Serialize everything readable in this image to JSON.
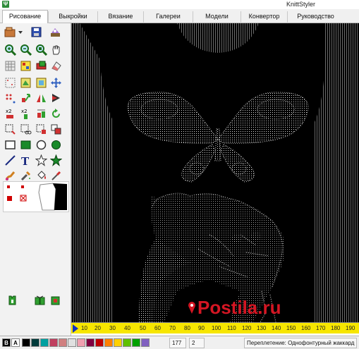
{
  "window": {
    "title": "KnittStyler",
    "icon_letter": "Ψ"
  },
  "tabs": [
    {
      "label": "Рисование",
      "active": true
    },
    {
      "label": "Выкройки",
      "active": false
    },
    {
      "label": "Вязание",
      "active": false
    },
    {
      "label": "Галереи",
      "active": false
    },
    {
      "label": "Модели",
      "active": false
    },
    {
      "label": "Конвертор",
      "active": false
    },
    {
      "label": "Руководство",
      "active": false
    }
  ],
  "tools": [
    "open-file-icon",
    "save-disk-icon",
    "print-icon",
    "zoom-in-icon",
    "zoom-out-icon",
    "zoom-fit-icon",
    "hand-pan-icon",
    "grid-icon",
    "stitch-pattern-icon",
    "rotate-icon",
    "eraser-icon",
    "select-grid-icon",
    "fill-area-icon",
    "move-area-icon",
    "move-cross-icon",
    "dot-pattern-icon",
    "scale-icon",
    "mirror-icon",
    "flip-icon",
    "double-x2-icon",
    "double-y2-icon",
    "paste-icon",
    "rotate-arrow-icon",
    "select-rect-icon",
    "cut-icon",
    "select-irregular-icon",
    "copy-icon",
    "rectangle-icon",
    "filled-rectangle-icon",
    "ellipse-icon",
    "filled-ellipse-icon",
    "line-icon",
    "text-icon",
    "star-outline-icon",
    "star-filled-icon",
    "brush-icon",
    "spray-icon",
    "fill-bucket-icon",
    "eyedropper-icon",
    "knit-garment-icon",
    "knit-pattern-icon",
    "knit-preview-icon"
  ],
  "ruler": {
    "start_label": "10",
    "labels": [
      "20",
      "30",
      "40",
      "50",
      "60",
      "70",
      "80",
      "90",
      "100",
      "110",
      "120",
      "130",
      "140",
      "150",
      "160",
      "170",
      "180",
      "190"
    ]
  },
  "status": {
    "b_label": "B",
    "a_label": "A",
    "palette": [
      "#000000",
      "#003b3b",
      "#00a0a0",
      "#c04060",
      "#d08080",
      "#e0e0e0",
      "#f0a0b0",
      "#800040",
      "#c00000",
      "#ff8000",
      "#ffd000",
      "#60c000",
      "#00a000",
      "#8060c0"
    ],
    "position_value": "177",
    "count_value": "2",
    "weave_text": "Переплетение: Однофонтурный жаккард"
  },
  "watermark": {
    "text": "Postila.ru"
  }
}
